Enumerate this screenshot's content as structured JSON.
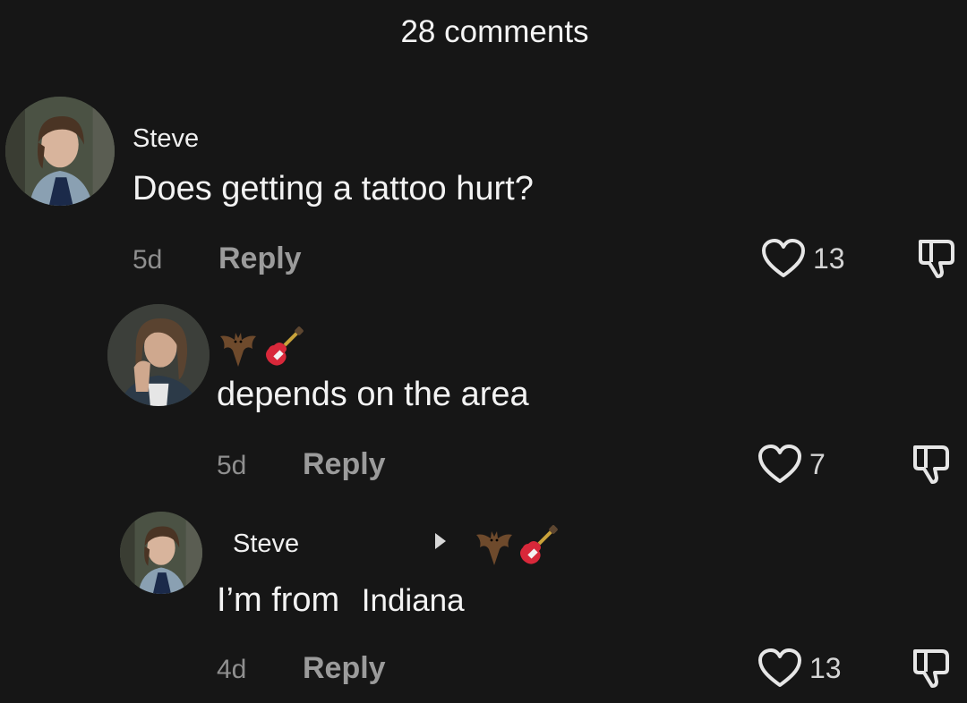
{
  "header": {
    "title": "28 comments"
  },
  "comments": [
    {
      "username": "Steve",
      "text": "Does getting a tattoo hurt?",
      "time": "5d",
      "reply_label": "Reply",
      "likes": "13"
    },
    {
      "username_emojis": [
        "bat-emoji",
        "guitar-emoji"
      ],
      "text": "depends on the area",
      "time": "5d",
      "reply_label": "Reply",
      "likes": "7"
    },
    {
      "username": "Steve",
      "reply_to_emojis": [
        "bat-emoji",
        "guitar-emoji"
      ],
      "text_prefix": "I’m from",
      "text_suffix": "Indiana",
      "time": "4d",
      "reply_label": "Reply",
      "likes": "13"
    }
  ],
  "colors": {
    "background": "#161616",
    "text": "#f3f3f3",
    "muted": "#8f8f8f"
  }
}
